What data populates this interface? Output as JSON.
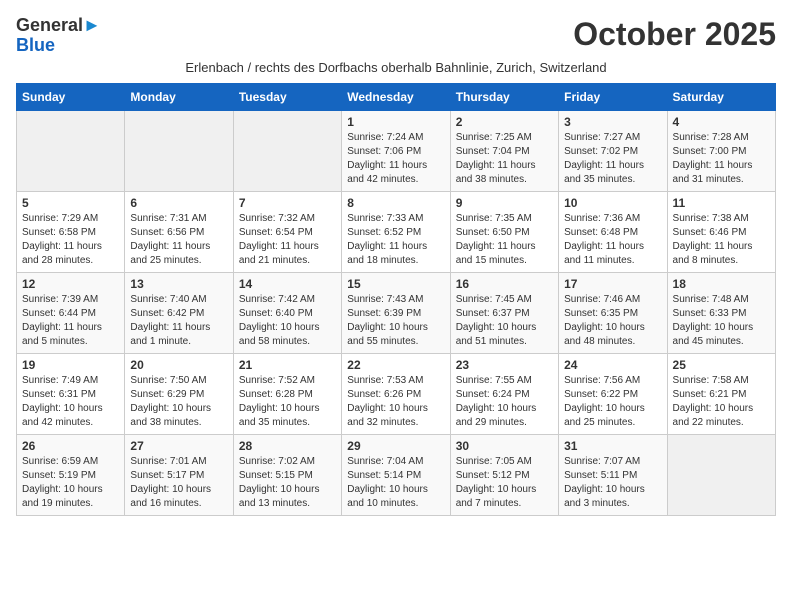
{
  "header": {
    "logo_general": "General",
    "logo_blue": "Blue",
    "month_title": "October 2025",
    "subtitle": "Erlenbach / rechts des Dorfbachs oberhalb Bahnlinie, Zurich, Switzerland"
  },
  "weekdays": [
    "Sunday",
    "Monday",
    "Tuesday",
    "Wednesday",
    "Thursday",
    "Friday",
    "Saturday"
  ],
  "weeks": [
    [
      {
        "day": "",
        "sunrise": "",
        "sunset": "",
        "daylight": ""
      },
      {
        "day": "",
        "sunrise": "",
        "sunset": "",
        "daylight": ""
      },
      {
        "day": "",
        "sunrise": "",
        "sunset": "",
        "daylight": ""
      },
      {
        "day": "1",
        "sunrise": "Sunrise: 7:24 AM",
        "sunset": "Sunset: 7:06 PM",
        "daylight": "Daylight: 11 hours and 42 minutes."
      },
      {
        "day": "2",
        "sunrise": "Sunrise: 7:25 AM",
        "sunset": "Sunset: 7:04 PM",
        "daylight": "Daylight: 11 hours and 38 minutes."
      },
      {
        "day": "3",
        "sunrise": "Sunrise: 7:27 AM",
        "sunset": "Sunset: 7:02 PM",
        "daylight": "Daylight: 11 hours and 35 minutes."
      },
      {
        "day": "4",
        "sunrise": "Sunrise: 7:28 AM",
        "sunset": "Sunset: 7:00 PM",
        "daylight": "Daylight: 11 hours and 31 minutes."
      }
    ],
    [
      {
        "day": "5",
        "sunrise": "Sunrise: 7:29 AM",
        "sunset": "Sunset: 6:58 PM",
        "daylight": "Daylight: 11 hours and 28 minutes."
      },
      {
        "day": "6",
        "sunrise": "Sunrise: 7:31 AM",
        "sunset": "Sunset: 6:56 PM",
        "daylight": "Daylight: 11 hours and 25 minutes."
      },
      {
        "day": "7",
        "sunrise": "Sunrise: 7:32 AM",
        "sunset": "Sunset: 6:54 PM",
        "daylight": "Daylight: 11 hours and 21 minutes."
      },
      {
        "day": "8",
        "sunrise": "Sunrise: 7:33 AM",
        "sunset": "Sunset: 6:52 PM",
        "daylight": "Daylight: 11 hours and 18 minutes."
      },
      {
        "day": "9",
        "sunrise": "Sunrise: 7:35 AM",
        "sunset": "Sunset: 6:50 PM",
        "daylight": "Daylight: 11 hours and 15 minutes."
      },
      {
        "day": "10",
        "sunrise": "Sunrise: 7:36 AM",
        "sunset": "Sunset: 6:48 PM",
        "daylight": "Daylight: 11 hours and 11 minutes."
      },
      {
        "day": "11",
        "sunrise": "Sunrise: 7:38 AM",
        "sunset": "Sunset: 6:46 PM",
        "daylight": "Daylight: 11 hours and 8 minutes."
      }
    ],
    [
      {
        "day": "12",
        "sunrise": "Sunrise: 7:39 AM",
        "sunset": "Sunset: 6:44 PM",
        "daylight": "Daylight: 11 hours and 5 minutes."
      },
      {
        "day": "13",
        "sunrise": "Sunrise: 7:40 AM",
        "sunset": "Sunset: 6:42 PM",
        "daylight": "Daylight: 11 hours and 1 minute."
      },
      {
        "day": "14",
        "sunrise": "Sunrise: 7:42 AM",
        "sunset": "Sunset: 6:40 PM",
        "daylight": "Daylight: 10 hours and 58 minutes."
      },
      {
        "day": "15",
        "sunrise": "Sunrise: 7:43 AM",
        "sunset": "Sunset: 6:39 PM",
        "daylight": "Daylight: 10 hours and 55 minutes."
      },
      {
        "day": "16",
        "sunrise": "Sunrise: 7:45 AM",
        "sunset": "Sunset: 6:37 PM",
        "daylight": "Daylight: 10 hours and 51 minutes."
      },
      {
        "day": "17",
        "sunrise": "Sunrise: 7:46 AM",
        "sunset": "Sunset: 6:35 PM",
        "daylight": "Daylight: 10 hours and 48 minutes."
      },
      {
        "day": "18",
        "sunrise": "Sunrise: 7:48 AM",
        "sunset": "Sunset: 6:33 PM",
        "daylight": "Daylight: 10 hours and 45 minutes."
      }
    ],
    [
      {
        "day": "19",
        "sunrise": "Sunrise: 7:49 AM",
        "sunset": "Sunset: 6:31 PM",
        "daylight": "Daylight: 10 hours and 42 minutes."
      },
      {
        "day": "20",
        "sunrise": "Sunrise: 7:50 AM",
        "sunset": "Sunset: 6:29 PM",
        "daylight": "Daylight: 10 hours and 38 minutes."
      },
      {
        "day": "21",
        "sunrise": "Sunrise: 7:52 AM",
        "sunset": "Sunset: 6:28 PM",
        "daylight": "Daylight: 10 hours and 35 minutes."
      },
      {
        "day": "22",
        "sunrise": "Sunrise: 7:53 AM",
        "sunset": "Sunset: 6:26 PM",
        "daylight": "Daylight: 10 hours and 32 minutes."
      },
      {
        "day": "23",
        "sunrise": "Sunrise: 7:55 AM",
        "sunset": "Sunset: 6:24 PM",
        "daylight": "Daylight: 10 hours and 29 minutes."
      },
      {
        "day": "24",
        "sunrise": "Sunrise: 7:56 AM",
        "sunset": "Sunset: 6:22 PM",
        "daylight": "Daylight: 10 hours and 25 minutes."
      },
      {
        "day": "25",
        "sunrise": "Sunrise: 7:58 AM",
        "sunset": "Sunset: 6:21 PM",
        "daylight": "Daylight: 10 hours and 22 minutes."
      }
    ],
    [
      {
        "day": "26",
        "sunrise": "Sunrise: 6:59 AM",
        "sunset": "Sunset: 5:19 PM",
        "daylight": "Daylight: 10 hours and 19 minutes."
      },
      {
        "day": "27",
        "sunrise": "Sunrise: 7:01 AM",
        "sunset": "Sunset: 5:17 PM",
        "daylight": "Daylight: 10 hours and 16 minutes."
      },
      {
        "day": "28",
        "sunrise": "Sunrise: 7:02 AM",
        "sunset": "Sunset: 5:15 PM",
        "daylight": "Daylight: 10 hours and 13 minutes."
      },
      {
        "day": "29",
        "sunrise": "Sunrise: 7:04 AM",
        "sunset": "Sunset: 5:14 PM",
        "daylight": "Daylight: 10 hours and 10 minutes."
      },
      {
        "day": "30",
        "sunrise": "Sunrise: 7:05 AM",
        "sunset": "Sunset: 5:12 PM",
        "daylight": "Daylight: 10 hours and 7 minutes."
      },
      {
        "day": "31",
        "sunrise": "Sunrise: 7:07 AM",
        "sunset": "Sunset: 5:11 PM",
        "daylight": "Daylight: 10 hours and 3 minutes."
      },
      {
        "day": "",
        "sunrise": "",
        "sunset": "",
        "daylight": ""
      }
    ]
  ]
}
